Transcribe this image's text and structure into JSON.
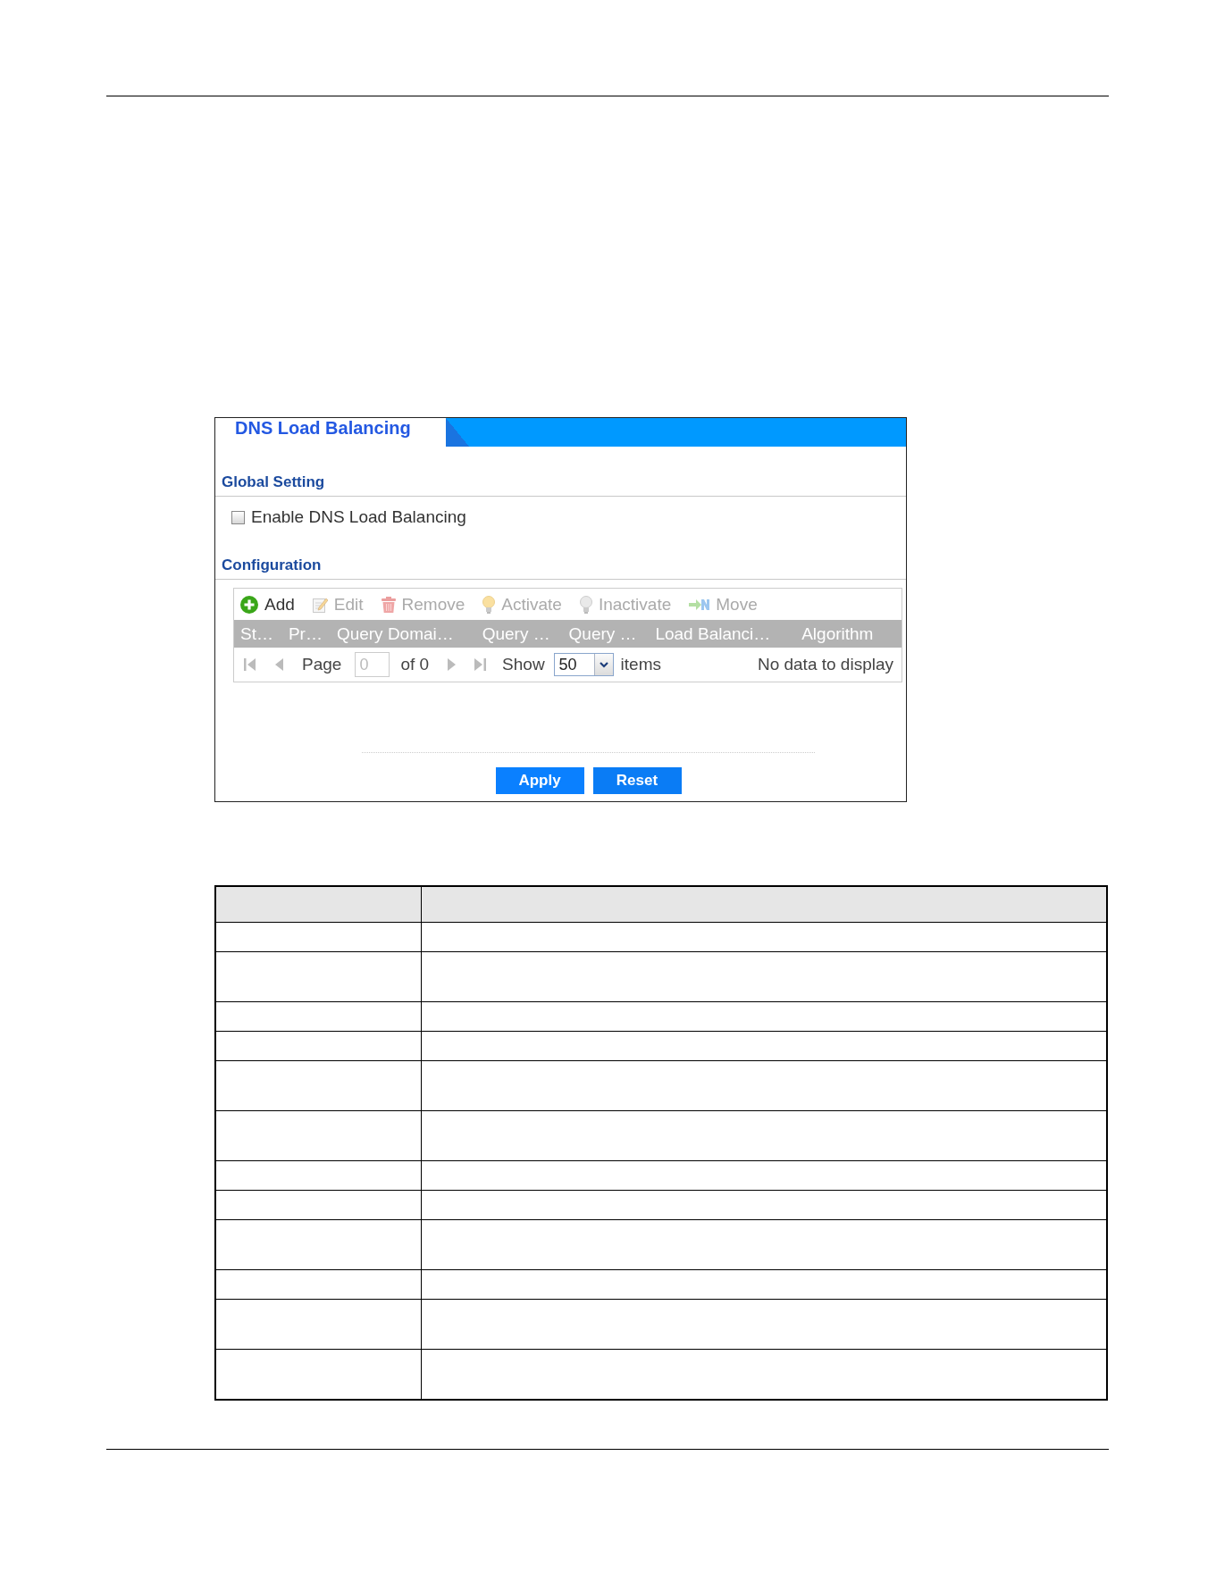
{
  "panel": {
    "title": "DNS Load Balancing"
  },
  "global_setting": {
    "heading": "Global Setting",
    "enable": {
      "label": "Enable DNS Load Balancing",
      "checked": false
    }
  },
  "configuration": {
    "heading": "Configuration",
    "toolbar": [
      {
        "kind": "add",
        "label": "Add",
        "disabled": false
      },
      {
        "kind": "edit",
        "label": "Edit",
        "disabled": true
      },
      {
        "kind": "remove",
        "label": "Remove",
        "disabled": true
      },
      {
        "kind": "activate",
        "label": "Activate",
        "disabled": true
      },
      {
        "kind": "inactivate",
        "label": "Inactivate",
        "disabled": true
      },
      {
        "kind": "move",
        "label": "Move",
        "disabled": true
      }
    ],
    "columns": [
      "St…",
      "Pr…",
      "Query Domai…",
      "Query …",
      "Query …",
      "Load Balanci…",
      "Algorithm"
    ],
    "pager": {
      "page_label": "Page",
      "page_value": "0",
      "of_label": "of 0",
      "show_label": "Show",
      "per_page": "50",
      "items_label": "items",
      "status": "No data to display",
      "nav_disabled": true
    }
  },
  "buttons": [
    {
      "kind": "apply",
      "label": "Apply"
    },
    {
      "kind": "reset",
      "label": "Reset"
    }
  ],
  "table": {
    "rows": [
      {
        "kind": "short"
      },
      {
        "kind": "tall"
      },
      {
        "kind": "short"
      },
      {
        "kind": "short"
      },
      {
        "kind": "tall"
      },
      {
        "kind": "tall"
      },
      {
        "kind": "short"
      },
      {
        "kind": "short"
      },
      {
        "kind": "tall"
      },
      {
        "kind": "short"
      },
      {
        "kind": "tall"
      },
      {
        "kind": "tall"
      }
    ]
  }
}
